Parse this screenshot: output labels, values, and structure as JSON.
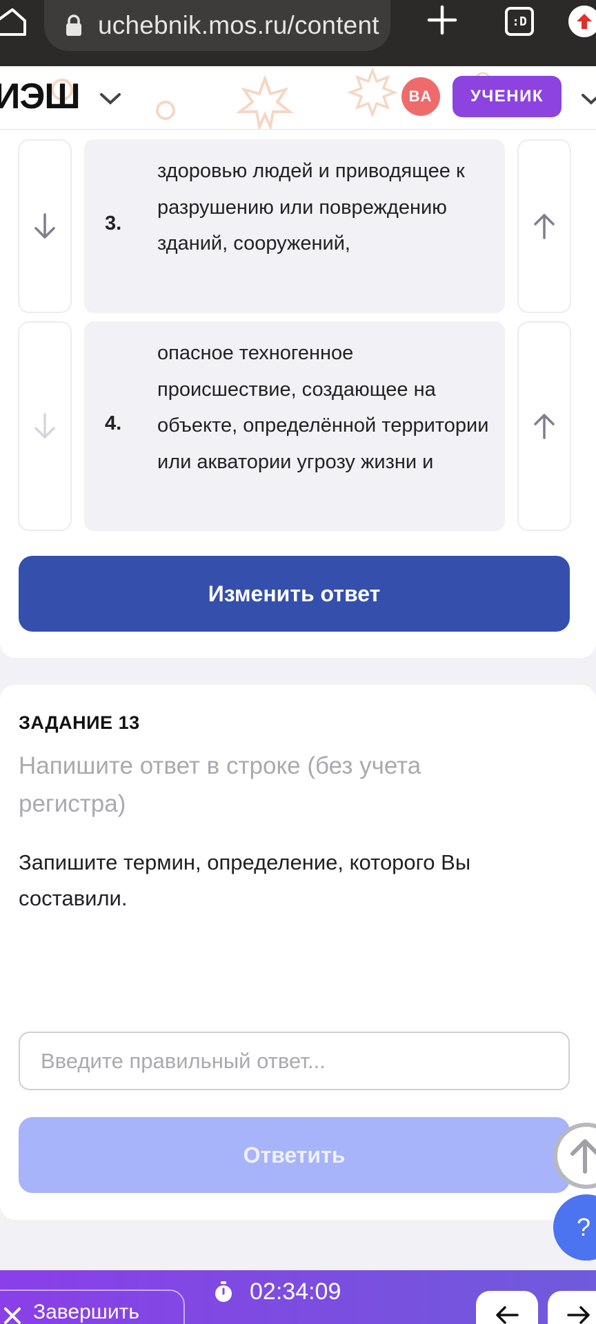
{
  "browser": {
    "url": "uchebnik.mos.ru/content",
    "tabs_label": ":D"
  },
  "header": {
    "logo": "ИЭШ",
    "avatar_initials": "ВА",
    "role": "УЧЕНИК"
  },
  "ordering": {
    "items": [
      {
        "number": "3.",
        "text": "здоровью людей и приводящее к разрушению или повреждению зданий, сооружений,"
      },
      {
        "number": "4.",
        "text": "опасное техногенное происшествие, создающее на объекте, определённой территории или акватории угрозу жизни и"
      }
    ],
    "change_button": "Изменить ответ"
  },
  "task": {
    "title": "ЗАДАНИЕ 13",
    "hint": "Напишите ответ в строке (без учета регистра)",
    "question": "Запишите термин, определение, которого Вы составили.",
    "input_placeholder": "Введите правильный ответ...",
    "input_value": "",
    "submit_button": "Ответить"
  },
  "bottom_bar": {
    "finish_label": "Завершить",
    "timer": "02:34:09"
  },
  "help_label": "?",
  "colors": {
    "primary_button": "#354fad",
    "disabled_button": "#a7b4f9",
    "role_badge": "#8c43e0",
    "avatar": "#ef6b6b",
    "help_button": "#4c73f0"
  }
}
